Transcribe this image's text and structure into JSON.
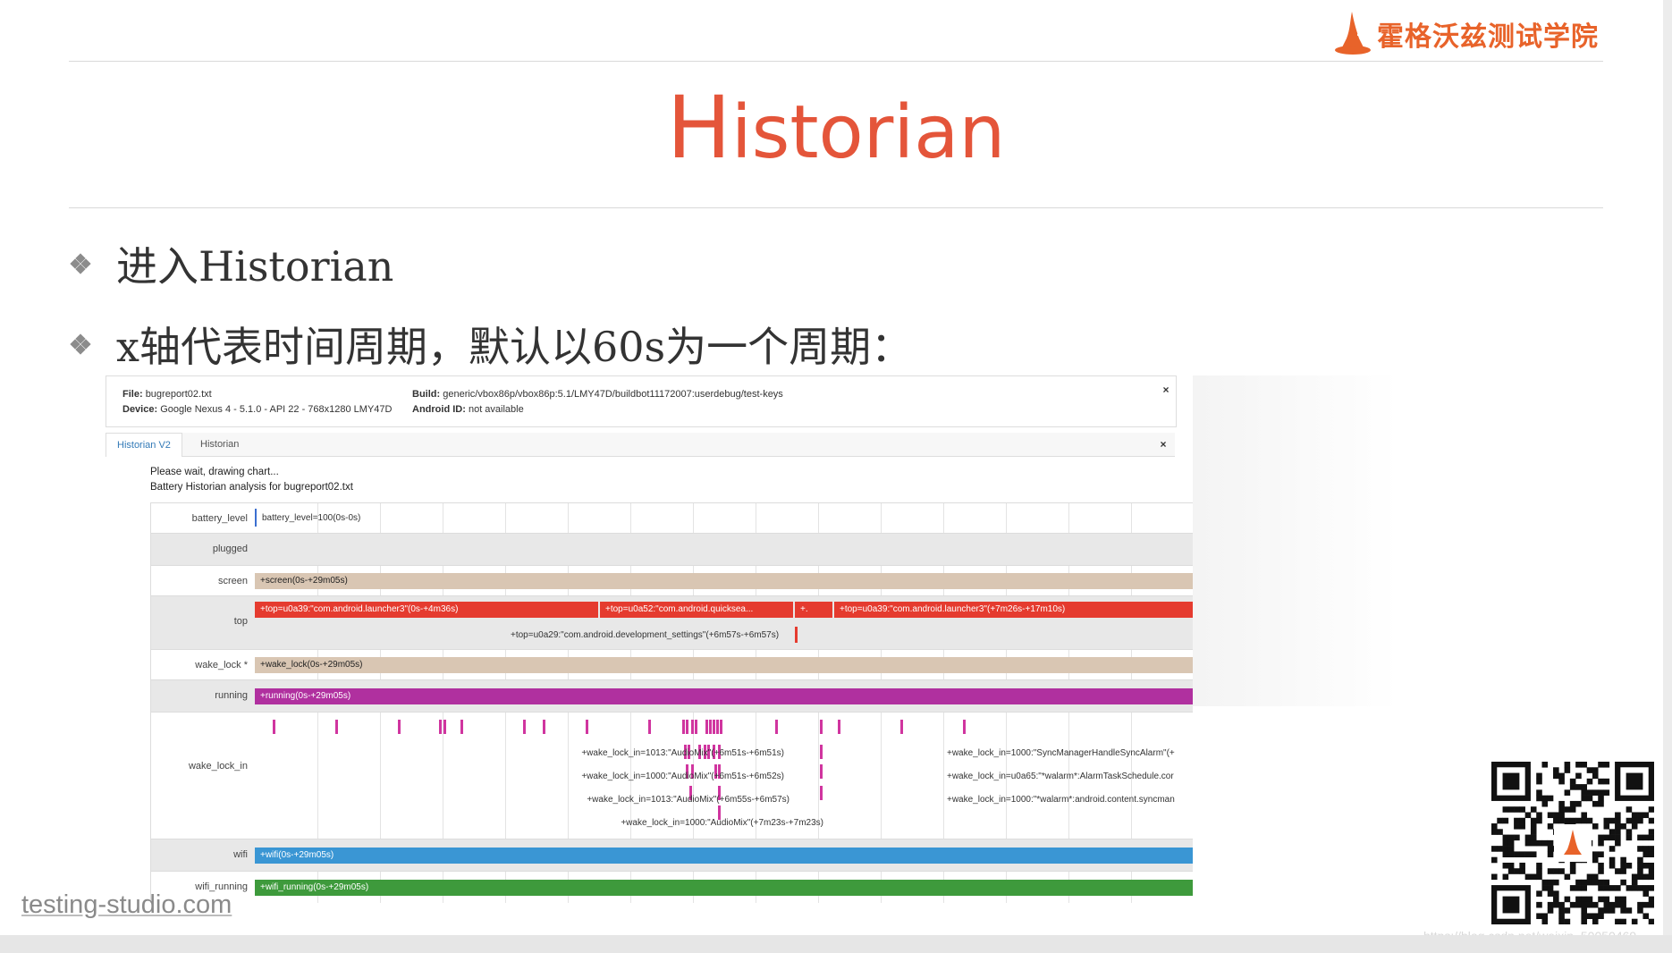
{
  "brand": {
    "name": "霍格沃兹测试学院"
  },
  "slide": {
    "title_first": "H",
    "title_rest": "istorian",
    "bullets": [
      "进入Historian",
      "x轴代表时间周期，默认以60s为一个周期："
    ]
  },
  "screenshot": {
    "file_label": "File:",
    "file_value": "bugreport02.txt",
    "device_label": "Device:",
    "device_value": "Google Nexus 4 - 5.1.0 - API 22 - 768x1280 LMY47D",
    "build_label": "Build:",
    "build_value": "generic/vbox86p/vbox86p:5.1/LMY47D/buildbot11172007:userdebug/test-keys",
    "android_id_label": "Android ID:",
    "android_id_value": "not available",
    "close": "×",
    "tabs": [
      {
        "label": "Historian V2",
        "active": true
      },
      {
        "label": "Historian",
        "active": false
      }
    ],
    "status_line1": "Please wait, drawing chart...",
    "status_line2": "Battery Historian analysis for bugreport02.txt",
    "rows": {
      "battery_level": {
        "label": "battery_level",
        "bar": "battery_level=100(0s-0s)"
      },
      "plugged": {
        "label": "plugged"
      },
      "screen": {
        "label": "screen",
        "bar": "+screen(0s-+29m05s)",
        "color": "#d9c6b3"
      },
      "top": {
        "label": "top",
        "bar1": "+top=u0a39:\"com.android.launcher3\"(0s-+4m36s)",
        "bar2": "+top=u0a52:\"com.android.quicksea...",
        "bar3": "+.",
        "bar4": "+top=u0a39:\"com.android.launcher3\"(+7m26s-+17m10s)",
        "line2": "+top=u0a29:\"com.android.development_settings\"(+6m57s-+6m57s)",
        "color": "#e53b2f"
      },
      "wake_lock": {
        "label": "wake_lock *",
        "bar": "+wake_lock(0s-+29m05s)",
        "color": "#d9c6b3"
      },
      "running": {
        "label": "running",
        "bar": "+running(0s-+29m05s)",
        "color": "#b0309f"
      },
      "wake_lock_in": {
        "label": "wake_lock_in",
        "left_texts": [
          "+wake_lock_in=1013:\"AudioMix\"(+6m51s-+6m51s)",
          "+wake_lock_in=1000:\"AudioMix\"(+6m51s-+6m52s)",
          "+wake_lock_in=1013:\"AudioMix\"(+6m55s-+6m57s)",
          "+wake_lock_in=1000:\"AudioMix\"(+7m23s-+7m23s)"
        ],
        "right_texts": [
          "+wake_lock_in=1000:\"SyncManagerHandleSyncAlarm\"(+",
          "+wake_lock_in=u0a65:\"*walarm*:AlarmTaskSchedule.cor",
          "+wake_lock_in=1000:\"*walarm*:android.content.syncman"
        ],
        "color": "#d0359f"
      },
      "wifi": {
        "label": "wifi",
        "bar": "+wifi(0s-+29m05s)",
        "color": "#3a96d4"
      },
      "wifi_running": {
        "label": "wifi_running",
        "bar": "+wifi_running(0s-+29m05s)",
        "color": "#3e9a3c"
      }
    }
  },
  "footer": {
    "site": "testing-studio.com",
    "watermark": "https://blog.csdn.net/weixin_50050469"
  }
}
